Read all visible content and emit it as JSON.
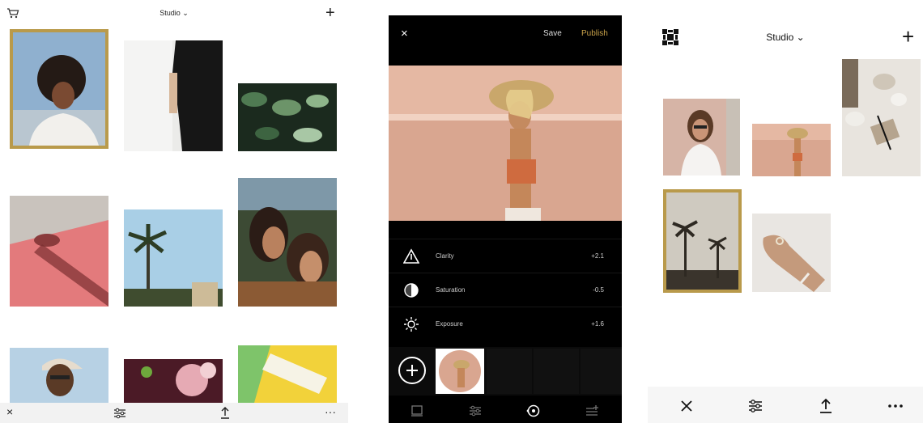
{
  "screen1": {
    "title": "Studio",
    "title_chevron": "⌄",
    "add_label": "+",
    "icons": {
      "cart": "cart-icon",
      "add": "plus-icon"
    },
    "bottom_bar": {
      "close": "×",
      "adjust": "sliders-icon",
      "share": "share-icon",
      "more": "···"
    },
    "accent_color": "#b99a4b"
  },
  "screen2": {
    "close": "×",
    "save": "Save",
    "publish": "Publish",
    "publish_color": "#c9a24a",
    "adjustments": [
      {
        "icon": "clarity-triangle-icon",
        "label": "Clarity",
        "value": "+2.1"
      },
      {
        "icon": "saturation-circle-icon",
        "label": "Saturation",
        "value": "-0.5"
      },
      {
        "icon": "exposure-sun-icon",
        "label": "Exposure",
        "value": "+1.6"
      }
    ],
    "toolbar_icons": [
      "presets-icon",
      "sliders-icon",
      "history-icon",
      "edit-list-icon"
    ]
  },
  "screen3": {
    "title": "Studio",
    "title_chevron": "⌄",
    "add_label": "+",
    "icons": {
      "logo": "vsco-logo-icon",
      "add": "plus-icon"
    },
    "bottom_bar": [
      "close-icon",
      "sliders-icon",
      "share-icon",
      "more-icon"
    ],
    "more_label": "···",
    "close_label": "×",
    "accent_color": "#b99a4b"
  }
}
